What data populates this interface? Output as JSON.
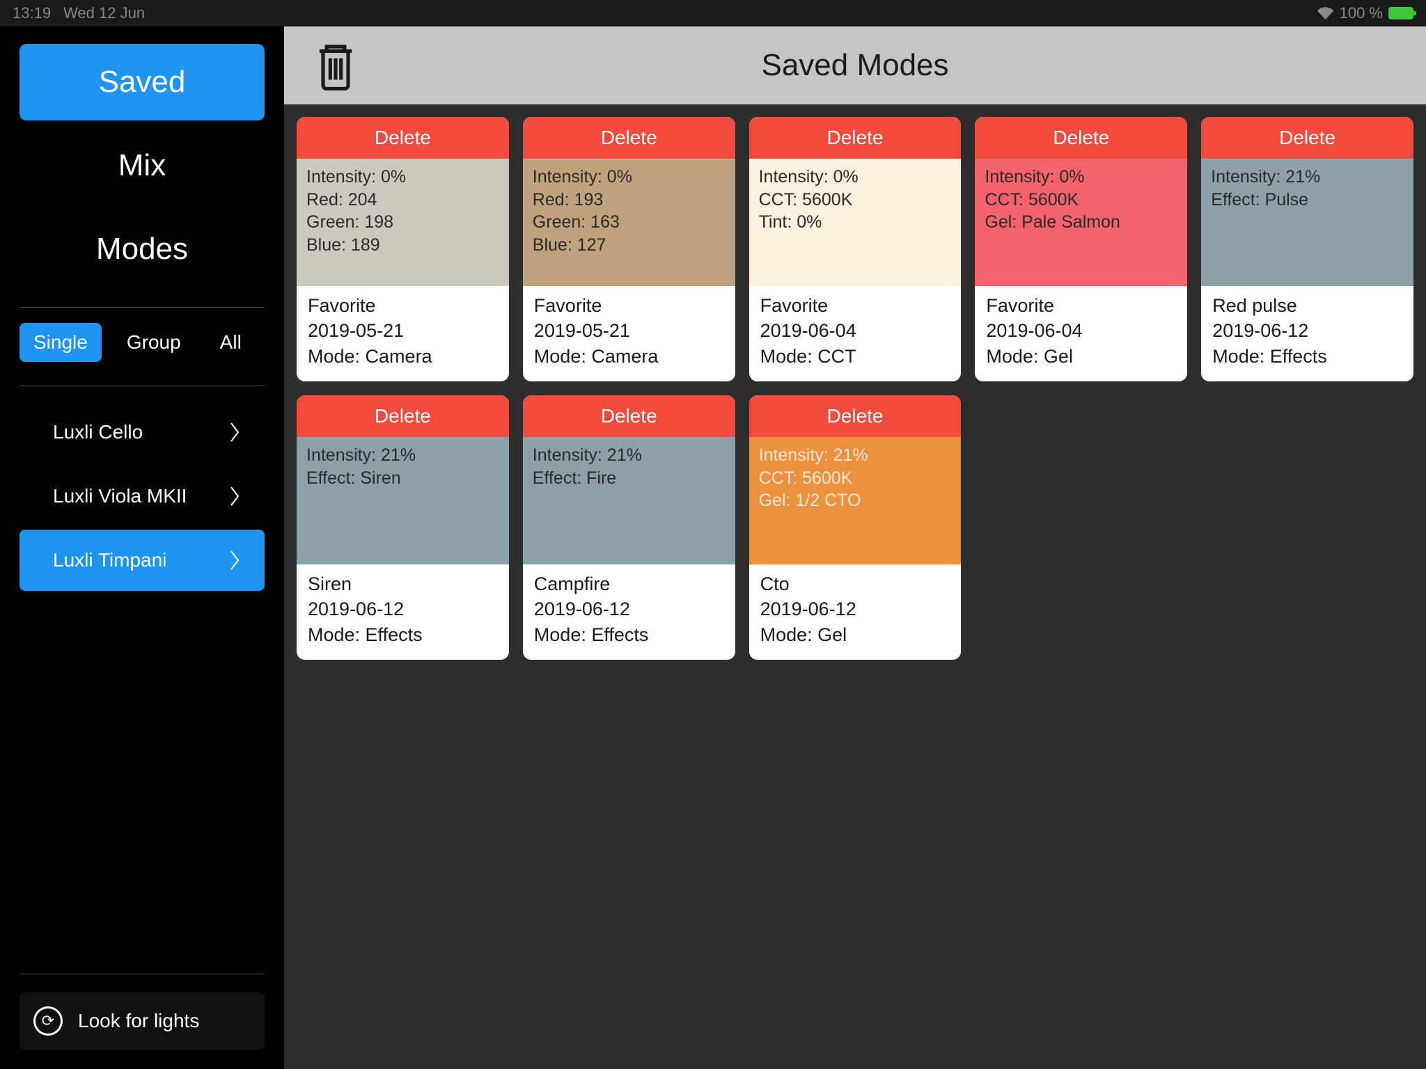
{
  "status": {
    "time": "13:19",
    "date": "Wed 12 Jun",
    "battery": "100 %"
  },
  "sidebar": {
    "nav": [
      {
        "label": "Saved",
        "active": true
      },
      {
        "label": "Mix",
        "active": false
      },
      {
        "label": "Modes",
        "active": false
      }
    ],
    "filters": [
      {
        "label": "Single",
        "active": true
      },
      {
        "label": "Group",
        "active": false
      },
      {
        "label": "All",
        "active": false
      }
    ],
    "devices": [
      {
        "label": "Luxli Cello",
        "selected": false
      },
      {
        "label": "Luxli Viola MKII",
        "selected": false
      },
      {
        "label": "Luxli Timpani",
        "selected": true
      }
    ],
    "look_label": "Look for lights"
  },
  "header": {
    "title": "Saved Modes"
  },
  "delete_label": "Delete",
  "cards": [
    {
      "swatch_color": "#cdc8be",
      "lines": [
        "Intensity: 0%",
        "Red: 204",
        "Green: 198",
        "Blue: 189"
      ],
      "name": "Favorite",
      "date": "2019-05-21",
      "mode": "Mode: Camera"
    },
    {
      "swatch_color": "#c0a27e",
      "lines": [
        "Intensity: 0%",
        "Red: 193",
        "Green: 163",
        "Blue: 127"
      ],
      "name": "Favorite",
      "date": "2019-05-21",
      "mode": "Mode: Camera"
    },
    {
      "swatch_color": "#fdf0df",
      "lines": [
        "Intensity: 0%",
        "CCT: 5600K",
        "Tint: 0%"
      ],
      "name": "Favorite",
      "date": "2019-06-04",
      "mode": "Mode: CCT"
    },
    {
      "swatch_color": "#f4636b",
      "lines": [
        "Intensity: 0%",
        "CCT: 5600K",
        "Gel: Pale Salmon"
      ],
      "name": "Favorite",
      "date": "2019-06-04",
      "mode": "Mode: Gel"
    },
    {
      "swatch_color": "#8da0aa",
      "lines": [
        "Intensity: 21%",
        "Effect: Pulse"
      ],
      "name": "Red pulse",
      "date": "2019-06-12",
      "mode": "Mode: Effects"
    },
    {
      "swatch_color": "#8da0aa",
      "lines": [
        "Intensity: 21%",
        "Effect: Siren"
      ],
      "name": "Siren",
      "date": "2019-06-12",
      "mode": "Mode: Effects"
    },
    {
      "swatch_color": "#8da0aa",
      "lines": [
        "Intensity: 21%",
        "Effect: Fire"
      ],
      "name": "Campfire",
      "date": "2019-06-12",
      "mode": "Mode: Effects"
    },
    {
      "swatch_color": "#ee913e",
      "light_text": true,
      "lines": [
        "Intensity: 21%",
        "CCT: 5600K",
        "Gel: 1/2 CTO"
      ],
      "name": "Cto",
      "date": "2019-06-12",
      "mode": "Mode: Gel"
    }
  ]
}
